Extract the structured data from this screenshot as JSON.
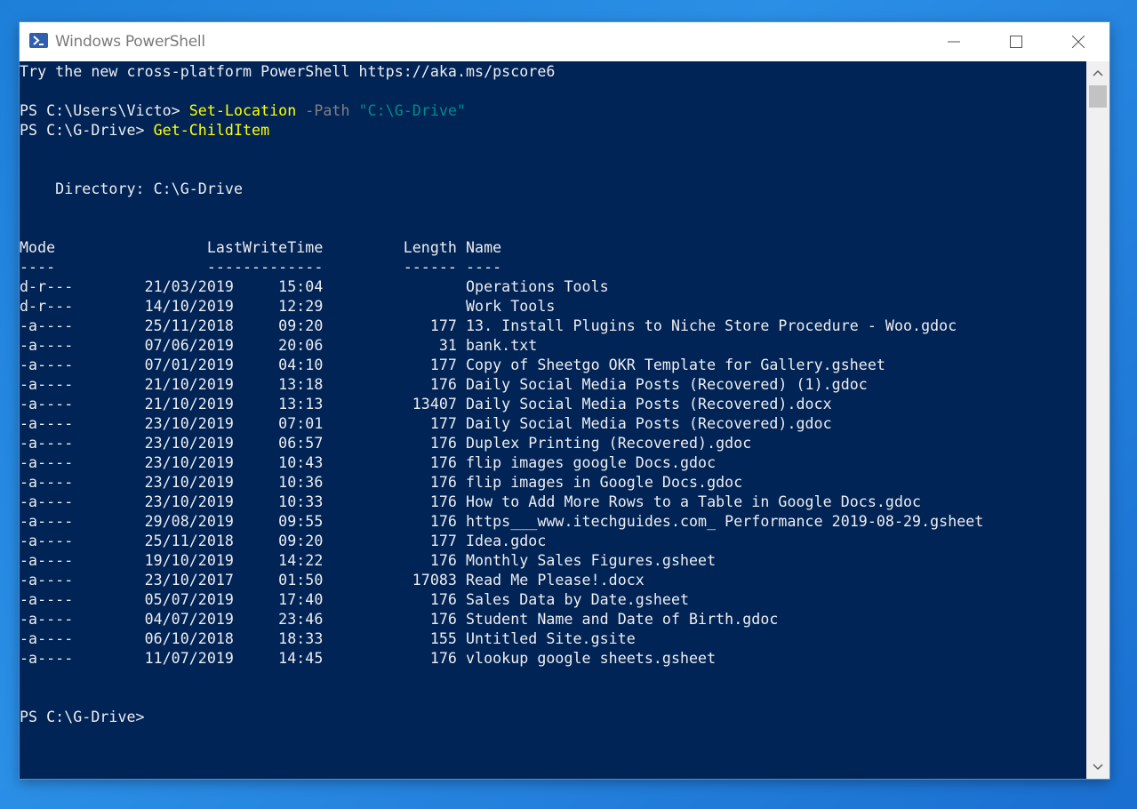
{
  "window": {
    "title": "Windows PowerShell",
    "app_icon": "powershell-icon",
    "controls": [
      "minimize-icon",
      "maximize-icon",
      "close-icon"
    ]
  },
  "console": {
    "banner": "Try the new cross-platform PowerShell https://aka.ms/pscore6",
    "cmd1": {
      "prompt": "PS C:\\Users\\Victo> ",
      "command": "Set-Location",
      "param": " -Path ",
      "value": "\"C:\\G-Drive\""
    },
    "cmd2": {
      "prompt": "PS C:\\G-Drive> ",
      "command": "Get-ChildItem"
    },
    "directory_line": "    Directory: C:\\G-Drive",
    "header_line": "Mode                 LastWriteTime         Length Name",
    "underline_line": "----                 -------------         ------ ----",
    "rows": [
      "d-r---        21/03/2019     15:04                Operations Tools",
      "d-r---        14/10/2019     12:29                Work Tools",
      "-a----        25/11/2018     09:20            177 13. Install Plugins to Niche Store Procedure - Woo.gdoc",
      "-a----        07/06/2019     20:06             31 bank.txt",
      "-a----        07/01/2019     04:10            177 Copy of Sheetgo OKR Template for Gallery.gsheet",
      "-a----        21/10/2019     13:18            176 Daily Social Media Posts (Recovered) (1).gdoc",
      "-a----        21/10/2019     13:13          13407 Daily Social Media Posts (Recovered).docx",
      "-a----        23/10/2019     07:01            177 Daily Social Media Posts (Recovered).gdoc",
      "-a----        23/10/2019     06:57            176 Duplex Printing (Recovered).gdoc",
      "-a----        23/10/2019     10:43            176 flip images google Docs.gdoc",
      "-a----        23/10/2019     10:36            176 flip images in Google Docs.gdoc",
      "-a----        23/10/2019     10:33            176 How to Add More Rows to a Table in Google Docs.gdoc",
      "-a----        29/08/2019     09:55            176 https___www.itechguides.com_ Performance 2019-08-29.gsheet",
      "-a----        25/11/2018     09:20            177 Idea.gdoc",
      "-a----        19/10/2019     14:22            176 Monthly Sales Figures.gsheet",
      "-a----        23/10/2017     01:50          17083 Read Me Please!.docx",
      "-a----        05/07/2019     17:40            176 Sales Data by Date.gsheet",
      "-a----        04/07/2019     23:46            176 Student Name and Date of Birth.gdoc",
      "-a----        06/10/2018     18:33            155 Untitled Site.gsite",
      "-a----        11/07/2019     14:45            176 vlookup google sheets.gsheet"
    ],
    "final_prompt": "PS C:\\G-Drive>"
  },
  "scrollbar": {
    "up_icon": "scroll-up-arrow-icon",
    "down_icon": "scroll-down-arrow-icon"
  }
}
